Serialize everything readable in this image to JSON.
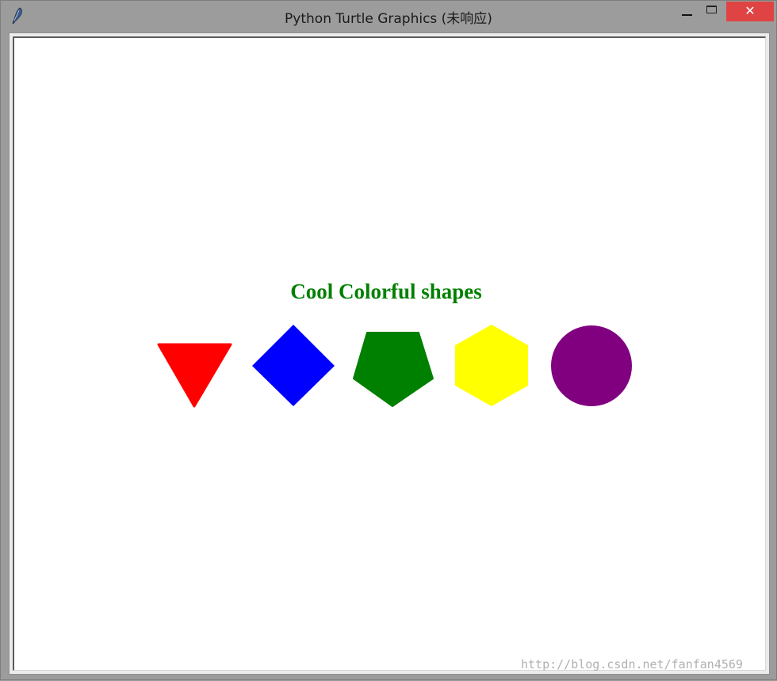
{
  "window": {
    "title": "Python Turtle Graphics (未响应)",
    "close_label": "✕"
  },
  "canvas": {
    "heading": "Cool Colorful shapes",
    "heading_color": "#008000",
    "shapes": [
      {
        "name": "triangle",
        "color": "#ff0000"
      },
      {
        "name": "square",
        "color": "#0000ff"
      },
      {
        "name": "pentagon",
        "color": "#008000"
      },
      {
        "name": "hexagon",
        "color": "#ffff00"
      },
      {
        "name": "circle",
        "color": "#800080"
      }
    ]
  },
  "watermark": "http://blog.csdn.net/fanfan4569"
}
